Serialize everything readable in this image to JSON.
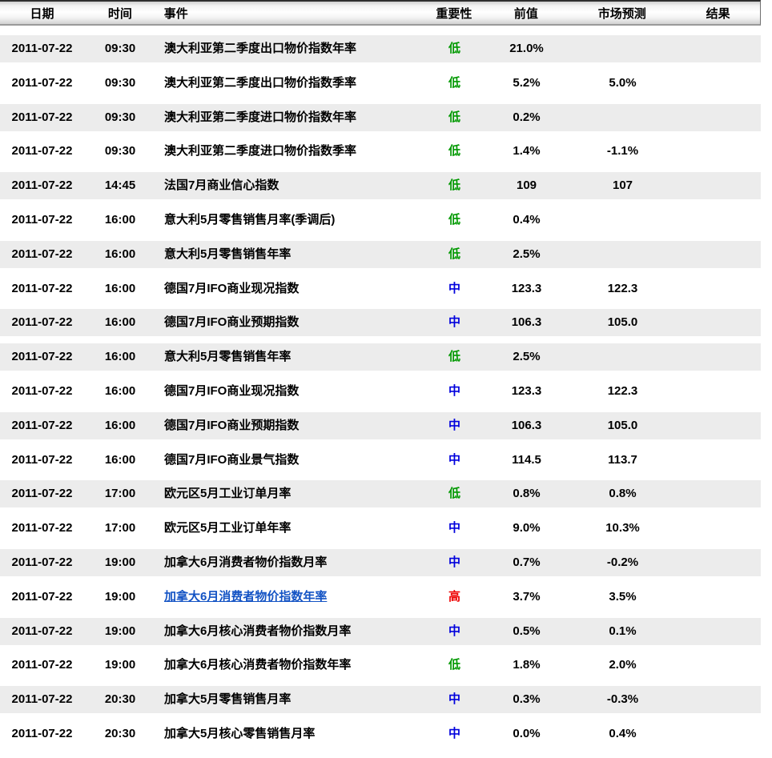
{
  "table": {
    "columns": [
      "日期",
      "时间",
      "事件",
      "重要性",
      "前值",
      "市场预测",
      "结果"
    ],
    "rows": [
      {
        "date": "2011-07-22",
        "time": "09:30",
        "event": "澳大利亚第二季度出口物价指数年率",
        "importance": "低",
        "level": "low",
        "previous": "21.0%",
        "forecast": "",
        "result": "",
        "shaded": true,
        "link": false
      },
      {
        "date": "2011-07-22",
        "time": "09:30",
        "event": "澳大利亚第二季度出口物价指数季率",
        "importance": "低",
        "level": "low",
        "previous": "5.2%",
        "forecast": "5.0%",
        "result": "",
        "shaded": false,
        "link": false
      },
      {
        "date": "2011-07-22",
        "time": "09:30",
        "event": "澳大利亚第二季度进口物价指数年率",
        "importance": "低",
        "level": "low",
        "previous": "0.2%",
        "forecast": "",
        "result": "",
        "shaded": true,
        "link": false
      },
      {
        "date": "2011-07-22",
        "time": "09:30",
        "event": "澳大利亚第二季度进口物价指数季率",
        "importance": "低",
        "level": "low",
        "previous": "1.4%",
        "forecast": "-1.1%",
        "result": "",
        "shaded": false,
        "link": false
      },
      {
        "date": "2011-07-22",
        "time": "14:45",
        "event": "法国7月商业信心指数",
        "importance": "低",
        "level": "low",
        "previous": "109",
        "forecast": "107",
        "result": "",
        "shaded": true,
        "link": false
      },
      {
        "date": "2011-07-22",
        "time": "16:00",
        "event": "意大利5月零售销售月率(季调后)",
        "importance": "低",
        "level": "low",
        "previous": "0.4%",
        "forecast": "",
        "result": "",
        "shaded": false,
        "link": false
      },
      {
        "date": "2011-07-22",
        "time": "16:00",
        "event": "意大利5月零售销售年率",
        "importance": "低",
        "level": "low",
        "previous": "2.5%",
        "forecast": "",
        "result": "",
        "shaded": true,
        "link": false
      },
      {
        "date": "2011-07-22",
        "time": "16:00",
        "event": "德国7月IFO商业现况指数",
        "importance": "中",
        "level": "medium",
        "previous": "123.3",
        "forecast": "122.3",
        "result": "",
        "shaded": false,
        "link": false
      },
      {
        "date": "2011-07-22",
        "time": "16:00",
        "event": "德国7月IFO商业预期指数",
        "importance": "中",
        "level": "medium",
        "previous": "106.3",
        "forecast": "105.0",
        "result": "",
        "shaded": true,
        "link": false
      },
      {
        "date": "2011-07-22",
        "time": "16:00",
        "event": "意大利5月零售销售年率",
        "importance": "低",
        "level": "low",
        "previous": "2.5%",
        "forecast": "",
        "result": "",
        "shaded": true,
        "link": false
      },
      {
        "date": "2011-07-22",
        "time": "16:00",
        "event": "德国7月IFO商业现况指数",
        "importance": "中",
        "level": "medium",
        "previous": "123.3",
        "forecast": "122.3",
        "result": "",
        "shaded": false,
        "link": false
      },
      {
        "date": "2011-07-22",
        "time": "16:00",
        "event": "德国7月IFO商业预期指数",
        "importance": "中",
        "level": "medium",
        "previous": "106.3",
        "forecast": "105.0",
        "result": "",
        "shaded": true,
        "link": false
      },
      {
        "date": "2011-07-22",
        "time": "16:00",
        "event": "德国7月IFO商业景气指数",
        "importance": "中",
        "level": "medium",
        "previous": "114.5",
        "forecast": "113.7",
        "result": "",
        "shaded": false,
        "link": false
      },
      {
        "date": "2011-07-22",
        "time": "17:00",
        "event": "欧元区5月工业订单月率",
        "importance": "低",
        "level": "low",
        "previous": "0.8%",
        "forecast": "0.8%",
        "result": "",
        "shaded": true,
        "link": false
      },
      {
        "date": "2011-07-22",
        "time": "17:00",
        "event": "欧元区5月工业订单年率",
        "importance": "中",
        "level": "medium",
        "previous": "9.0%",
        "forecast": "10.3%",
        "result": "",
        "shaded": false,
        "link": false
      },
      {
        "date": "2011-07-22",
        "time": "19:00",
        "event": "加拿大6月消费者物价指数月率",
        "importance": "中",
        "level": "medium",
        "previous": "0.7%",
        "forecast": "-0.2%",
        "result": "",
        "shaded": true,
        "link": false
      },
      {
        "date": "2011-07-22",
        "time": "19:00",
        "event": "加拿大6月消费者物价指数年率",
        "importance": "高",
        "level": "high",
        "previous": "3.7%",
        "forecast": "3.5%",
        "result": "",
        "shaded": false,
        "link": true
      },
      {
        "date": "2011-07-22",
        "time": "19:00",
        "event": "加拿大6月核心消费者物价指数月率",
        "importance": "中",
        "level": "medium",
        "previous": "0.5%",
        "forecast": "0.1%",
        "result": "",
        "shaded": true,
        "link": false
      },
      {
        "date": "2011-07-22",
        "time": "19:00",
        "event": "加拿大6月核心消费者物价指数年率",
        "importance": "低",
        "level": "low",
        "previous": "1.8%",
        "forecast": "2.0%",
        "result": "",
        "shaded": false,
        "link": false
      },
      {
        "date": "2011-07-22",
        "time": "20:30",
        "event": "加拿大5月零售销售月率",
        "importance": "中",
        "level": "medium",
        "previous": "0.3%",
        "forecast": "-0.3%",
        "result": "",
        "shaded": true,
        "link": false
      },
      {
        "date": "2011-07-22",
        "time": "20:30",
        "event": "加拿大5月核心零售销售月率",
        "importance": "中",
        "level": "medium",
        "previous": "0.0%",
        "forecast": "0.4%",
        "result": "",
        "shaded": false,
        "link": false
      }
    ]
  },
  "colors": {
    "importance_low": "#009900",
    "importance_medium": "#0000dd",
    "importance_high": "#ee0000",
    "event_link": "#1353c4",
    "row_shaded": "#ececec"
  }
}
